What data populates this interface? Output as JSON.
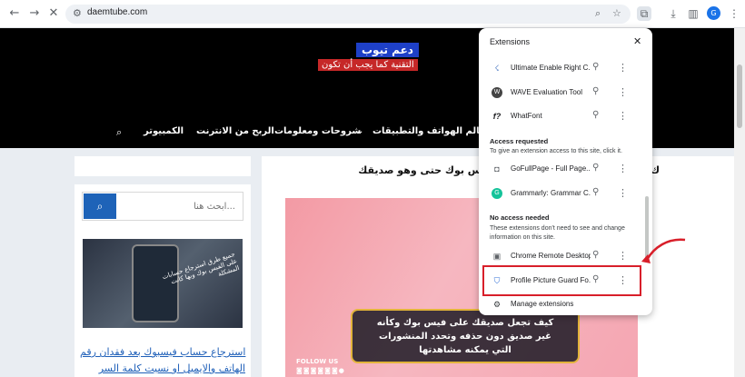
{
  "browser": {
    "url": "daemtube.com",
    "avatar_letter": "G"
  },
  "site": {
    "logo_title": "دعم تيوب",
    "logo_tagline": "التقنية كما يجب أن تكون",
    "nav": [
      "عالم الهواتف والتطبيقات",
      "شروحات ومعلومات",
      "الربح من الانترنت",
      "الكمبيوتر"
    ],
    "search_placeholder": "ابحث هنا...",
    "thumbnail_caption": "جميع طرق استرجاع حسابات على الفيس بوك وبها كانت المشكلة",
    "sidebar_link_1": "استرجاع حساب فيسبوك بعد فقدان رقم",
    "sidebar_link_2": "الهاتف والايميل او نسيت كلمة السر",
    "post_title": "س بوك حتى وهو صديقك",
    "post_title_right": "ك",
    "banner_line1": "كيف تجعل صديقك على فيس بوك وكأنه",
    "banner_line2": "غير صديق دون حذفه وتحدد المنشورات",
    "banner_line3": "التي يمكنه مشاهدتها",
    "follow_us": "FOLLOW US"
  },
  "extensions": {
    "title": "Extensions",
    "items_top": [
      {
        "name": "Ultimate Enable Right C...",
        "icon": "cursor-icon"
      },
      {
        "name": "WAVE Evaluation Tool",
        "icon": "wave-icon"
      },
      {
        "name": "WhatFont",
        "icon": "font-icon"
      }
    ],
    "access_requested_heading": "Access requested",
    "access_requested_desc": "To give an extension access to this site, click it.",
    "items_requested": [
      {
        "name": "GoFullPage - Full Page...",
        "icon": "camera-icon"
      },
      {
        "name": "Grammarly: Grammar C...",
        "icon": "grammarly-icon"
      }
    ],
    "no_access_heading": "No access needed",
    "no_access_desc": "These extensions don't need to see and change information on this site.",
    "items_no_access": [
      {
        "name": "Chrome Remote Desktop",
        "icon": "remote-desktop-icon"
      },
      {
        "name": "Profile Picture Guard Fo...",
        "icon": "shield-icon"
      }
    ],
    "manage_label": "Manage extensions"
  },
  "colors": {
    "highlight": "#d81f2a",
    "brand_blue": "#1e63b8"
  }
}
